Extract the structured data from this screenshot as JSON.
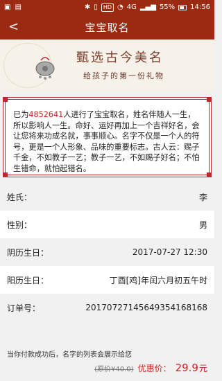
{
  "status_bar": {
    "hd": "HD",
    "signal": "4G",
    "battery": "55%",
    "time": "14:56"
  },
  "nav": {
    "back": "<",
    "title": "宝宝取名"
  },
  "banner": {
    "headline": "甄选古今美名",
    "subline": "给孩子的第一份礼物"
  },
  "intro": {
    "prefix": "已为",
    "count": "4852641",
    "suffix": "人进行了宝宝取名，姓名伴随人一生，所以影响人一生。命好、运好再加上一个吉祥好名，会让您将来功成名就，事事顺心。名字不仅是一个人的符号，更是一个人形象、品味的重要标志。古人云：赐子千金，不如教子一艺；教子一艺，不如赐子好名；不怕生错命，就怕起错名。"
  },
  "fields": [
    {
      "label": "姓氏：",
      "value": "李"
    },
    {
      "label": "性别：",
      "value": "男"
    },
    {
      "label": "阴历生日：",
      "value": "2017-07-27 12:30"
    },
    {
      "label": "阳历生日：",
      "value": "丁酉[鸡]年闰六月初五午时"
    },
    {
      "label": "订单号：",
      "value": "20170727145649354168168"
    }
  ],
  "notice": "当你付款成功后，名字的列表会展示给您",
  "price": {
    "original": "(原价¥40.0)",
    "deal_label": "优惠价：",
    "deal_value": "29.9",
    "deal_unit": "元"
  },
  "colors": {
    "brand": "#9b2a12",
    "accent": "#d01f1f"
  }
}
